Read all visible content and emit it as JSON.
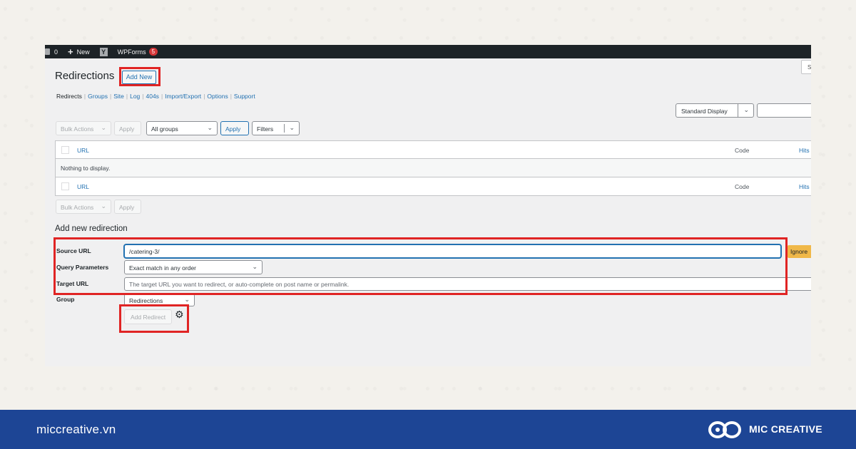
{
  "admin_bar": {
    "comments_count": "0",
    "new_label": "New",
    "yoast_glyph": "Y",
    "wpforms_label": "WPForms",
    "wpforms_badge": "5"
  },
  "top_right_partial": "S",
  "page": {
    "title": "Redirections",
    "add_new": "Add New"
  },
  "subnav": [
    {
      "label": "Redirects",
      "current": true
    },
    {
      "label": "Groups"
    },
    {
      "label": "Site"
    },
    {
      "label": "Log"
    },
    {
      "label": "404s"
    },
    {
      "label": "Import/Export"
    },
    {
      "label": "Options"
    },
    {
      "label": "Support"
    }
  ],
  "subnav_separator": "|",
  "display_select": "Standard Display",
  "toolbar": {
    "bulk_actions": "Bulk Actions",
    "apply": "Apply",
    "group_filter": "All groups",
    "filters": "Filters"
  },
  "table": {
    "columns": {
      "url": "URL",
      "code": "Code",
      "hits": "Hits"
    },
    "empty_message": "Nothing to display."
  },
  "add_redirection": {
    "section_title": "Add new redirection",
    "source_url_label": "Source URL",
    "source_url_value": "/catering-3/",
    "ignore_label": "Ignore",
    "query_params_label": "Query Parameters",
    "query_params_value": "Exact match in any order",
    "target_url_label": "Target URL",
    "target_url_placeholder": "The target URL you want to redirect, or auto-complete on post name or permalink.",
    "group_label": "Group",
    "group_value": "Redirections",
    "submit_label": "Add Redirect"
  },
  "footer": {
    "website": "miccreative.vn",
    "brand": "MIC CREATIVE"
  },
  "colors": {
    "highlight_red": "#e02424",
    "footer_blue": "#1d4595",
    "wp_link": "#2271b1",
    "ignore_button": "#f0b849"
  }
}
